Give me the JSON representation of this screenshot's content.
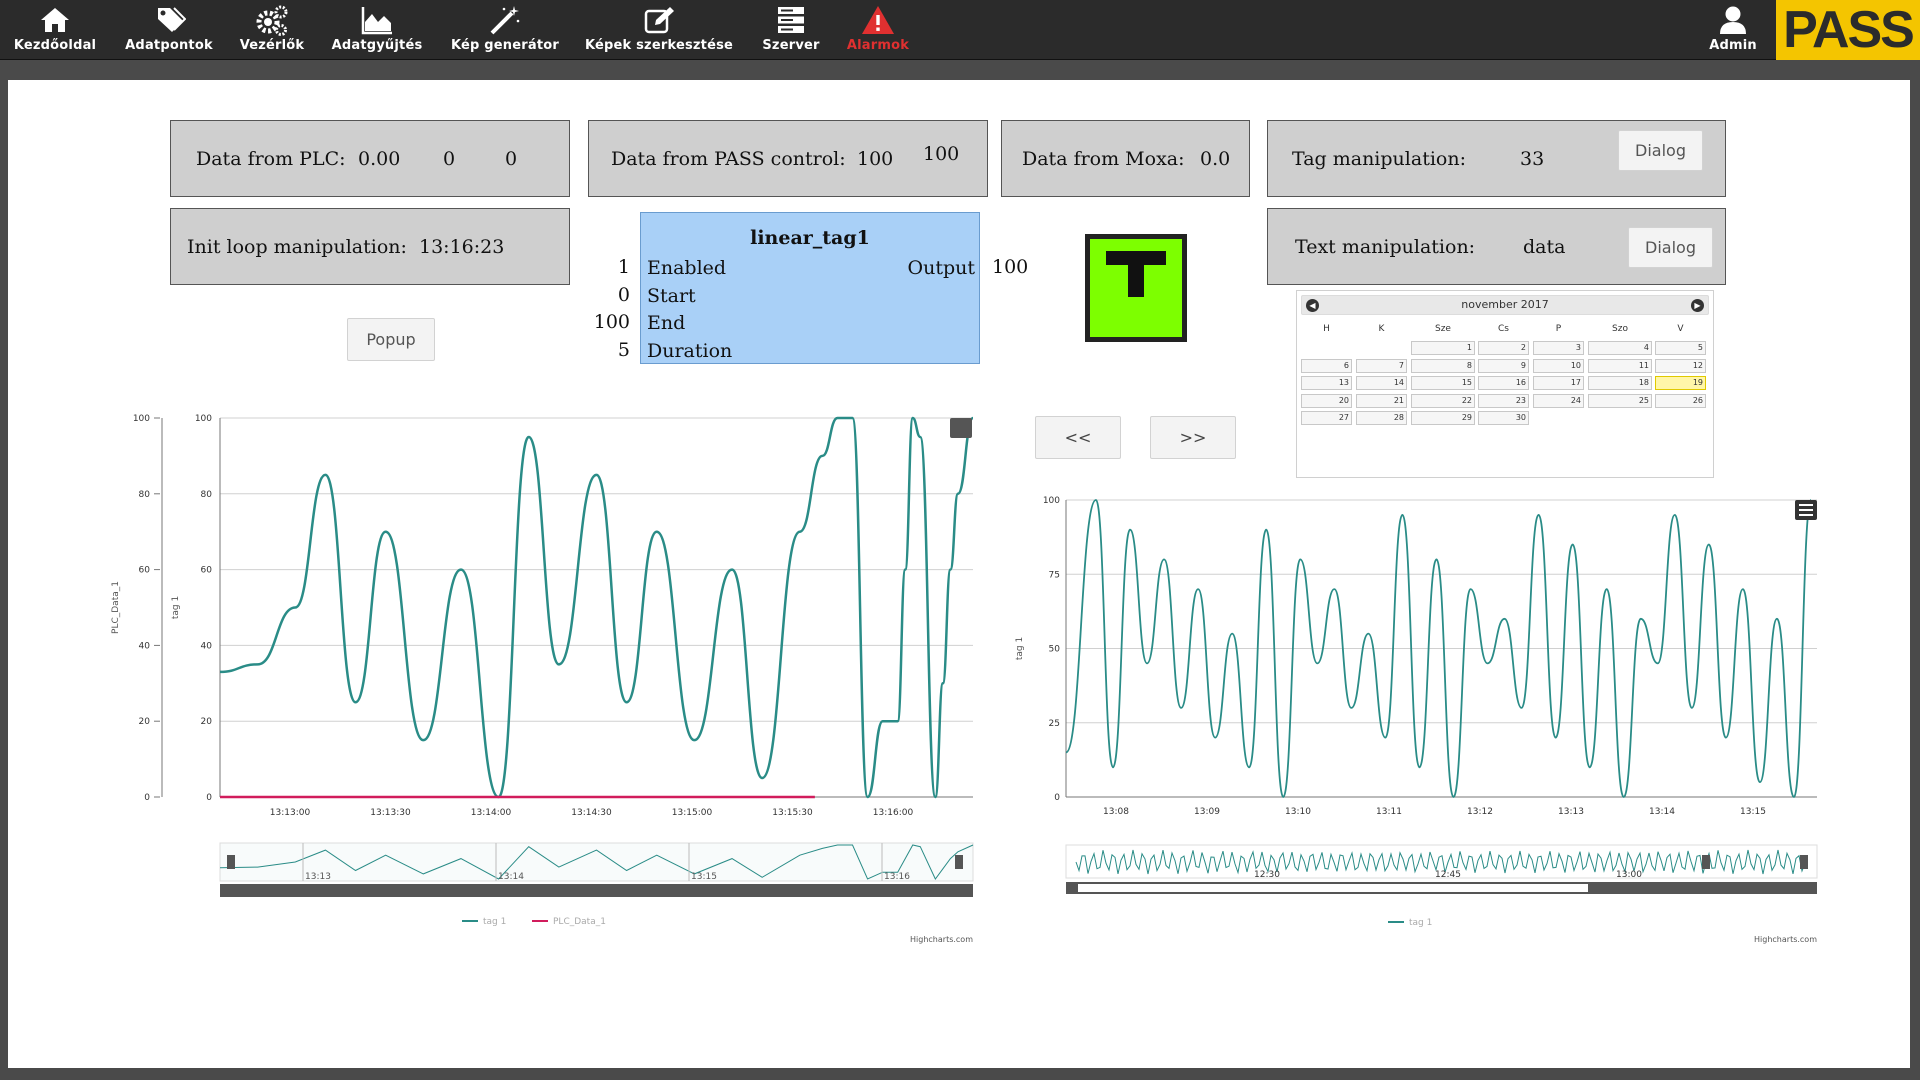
{
  "nav": {
    "items": [
      {
        "label": "Kezdőoldal",
        "icon": "home-icon"
      },
      {
        "label": "Adatpontok",
        "icon": "tag-icon"
      },
      {
        "label": "Vezérlők",
        "icon": "gears-icon"
      },
      {
        "label": "Adatgyűjtés",
        "icon": "area-chart-icon"
      },
      {
        "label": "Kép generátor",
        "icon": "magic-wand-icon"
      },
      {
        "label": "Képek szerkesztése",
        "icon": "edit-icon"
      },
      {
        "label": "Szerver",
        "icon": "server-icon"
      },
      {
        "label": "Alarmok",
        "icon": "warning-icon"
      }
    ],
    "user_label": "Admin",
    "logo_text": "PASS",
    "colors": {
      "bar": "#2b2b2b",
      "logo_bg": "#f4c500",
      "alarm": "#e03030"
    }
  },
  "panels": {
    "plc": {
      "label": "Data from PLC:",
      "v1": "0.00",
      "v2": "0",
      "v3": "0"
    },
    "pass": {
      "label": "Data from PASS control:",
      "v1": "100",
      "v2": "100"
    },
    "moxa": {
      "label": "Data from Moxa:",
      "v1": "0.0"
    },
    "tag": {
      "label": "Tag manipulation:",
      "value": "33",
      "button": "Dialog"
    },
    "init": {
      "label": "Init loop manipulation:",
      "value": "13:16:23"
    },
    "text": {
      "label": "Text manipulation:",
      "value": "data",
      "button": "Dialog"
    }
  },
  "popup_button": "Popup",
  "function_block": {
    "title": "linear_tag1",
    "inputs": [
      {
        "value": "1",
        "label": "Enabled"
      },
      {
        "value": "0",
        "label": "Start"
      },
      {
        "value": "100",
        "label": "End"
      },
      {
        "value": "5",
        "label": "Duration"
      }
    ],
    "output_label": "Output",
    "output_value": "100",
    "color": "#a9d0f7"
  },
  "indicator": {
    "letter_icon": "t-letter-icon",
    "color": "#7dff00"
  },
  "pager": {
    "prev": "<<",
    "next": ">>"
  },
  "calendar": {
    "month": "november 2017",
    "days_of_week": [
      "H",
      "K",
      "Sze",
      "Cs",
      "P",
      "Szo",
      "V"
    ],
    "today": "19",
    "days": [
      "1",
      "2",
      "3",
      "4",
      "5",
      "6",
      "7",
      "8",
      "9",
      "10",
      "11",
      "12",
      "13",
      "14",
      "15",
      "16",
      "17",
      "18",
      "19",
      "20",
      "21",
      "22",
      "23",
      "24",
      "25",
      "26",
      "27",
      "28",
      "29",
      "30"
    ]
  },
  "chart_data": [
    {
      "type": "line",
      "y_axes": [
        {
          "label": "PLC_Data_1",
          "ticks": [
            "0",
            "20",
            "40",
            "60",
            "80",
            "100"
          ],
          "range": [
            0,
            100
          ]
        },
        {
          "label": "tag 1",
          "ticks": [
            "0",
            "20",
            "40",
            "60",
            "80",
            "100"
          ],
          "range": [
            0,
            100
          ]
        }
      ],
      "x_ticks": [
        "13:13:00",
        "13:13:30",
        "13:14:00",
        "13:14:30",
        "13:15:00",
        "13:15:30",
        "13:16:00"
      ],
      "navigator_ticks": [
        "13:13",
        "13:14",
        "13:15",
        "13:16"
      ],
      "series": [
        {
          "name": "tag 1",
          "color": "#2a8c87",
          "x": [
            0,
            5,
            10,
            14,
            18,
            22,
            27,
            32,
            37,
            41,
            45,
            50,
            54,
            58,
            63,
            68,
            72,
            77,
            80,
            82,
            84,
            86,
            88,
            90,
            91,
            92,
            93,
            95,
            96,
            97,
            98,
            100
          ],
          "values": [
            33,
            35,
            50,
            85,
            25,
            70,
            15,
            60,
            0,
            95,
            35,
            85,
            25,
            70,
            15,
            60,
            5,
            70,
            90,
            100,
            100,
            0,
            20,
            20,
            60,
            100,
            95,
            0,
            30,
            60,
            80,
            100
          ]
        },
        {
          "name": "PLC_Data_1",
          "color": "#d11c5c",
          "x": [
            0,
            79
          ],
          "values": [
            0,
            0
          ]
        }
      ],
      "legend": [
        "tag 1",
        "PLC_Data_1"
      ],
      "credits": "Highcharts.com"
    },
    {
      "type": "line",
      "y_axes": [
        {
          "label": "tag 1",
          "ticks": [
            "0",
            "25",
            "50",
            "75",
            "100"
          ],
          "range": [
            0,
            100
          ]
        }
      ],
      "x_ticks": [
        "13:08",
        "13:09",
        "13:10",
        "13:11",
        "13:12",
        "13:13",
        "13:14",
        "13:15"
      ],
      "navigator_ticks": [
        "12:30",
        "12:45",
        "13:00"
      ],
      "series": [
        {
          "name": "tag 1",
          "color": "#2a8c87",
          "peaks": [
            100,
            90,
            80,
            70,
            55,
            90,
            80,
            70,
            55,
            95,
            80,
            70,
            60,
            95,
            85,
            70,
            60,
            95,
            85,
            70,
            60,
            100
          ],
          "troughs": [
            10,
            45,
            30,
            20,
            10,
            0,
            45,
            30,
            20,
            10,
            0,
            45,
            30,
            20,
            10,
            0,
            45,
            30,
            20,
            5,
            0
          ]
        }
      ],
      "legend": [
        "tag 1"
      ],
      "credits": "Highcharts.com"
    }
  ]
}
